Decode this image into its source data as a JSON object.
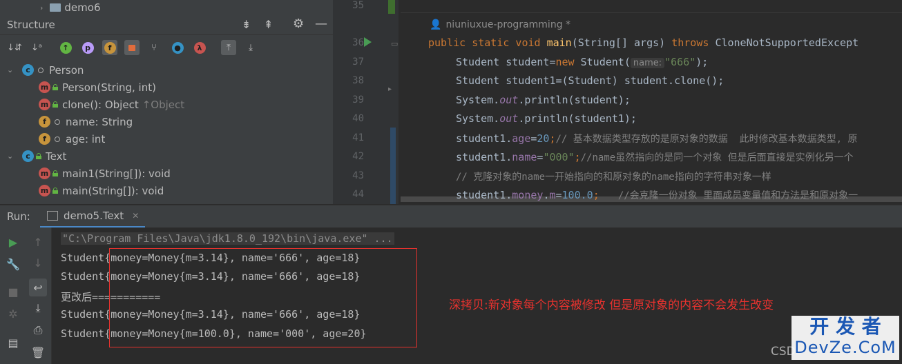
{
  "project_tree": {
    "folder_label": "demo6"
  },
  "structure": {
    "title": "Structure",
    "tree": [
      {
        "kind": "class",
        "label": "Person"
      },
      {
        "kind": "method",
        "label": "Person(String, int)"
      },
      {
        "kind": "method",
        "label": "clone(): Object",
        "suffix": "↑Object"
      },
      {
        "kind": "field",
        "label": "name: String"
      },
      {
        "kind": "field",
        "label": "age: int"
      },
      {
        "kind": "class",
        "label": "Text"
      },
      {
        "kind": "method",
        "label": "main1(String[]): void"
      },
      {
        "kind": "method",
        "label": "main(String[]): void"
      }
    ]
  },
  "editor": {
    "author_hint": "niuniuxue-programming *",
    "line_numbers": [
      "35",
      "36",
      "37",
      "38",
      "39",
      "40",
      "41",
      "42",
      "43",
      "44"
    ],
    "lines": {
      "l36": {
        "a": "public static void ",
        "fn": "main",
        "b": "(String[] args) ",
        "c": "throws ",
        "d": "CloneNotSupportedExcept"
      },
      "l37": {
        "a": "Student student=",
        "kw": "new ",
        "b": "Student(",
        "hint": "name:",
        "str": "\"666\"",
        "c": ");"
      },
      "l38": {
        "a": "Student student1=(Student) student.clone();"
      },
      "l39": {
        "a": "System.",
        "f": "out",
        "b": ".println(student);"
      },
      "l40": {
        "a": "System.",
        "f": "out",
        "b": ".println(student1);"
      },
      "l41": {
        "a": "student1.",
        "f": "age",
        "b": "=",
        "n": "20",
        "c": ";",
        "cm": "// 基本数据类型存放的是原对象的数据  此时修改基本数据类型, 原"
      },
      "l42": {
        "a": "student1.",
        "f": "name",
        "b": "=",
        "s": "\"000\"",
        "c": ";",
        "cm": "//name虽然指向的是同一个对象 但是后面直接是实例化另一个"
      },
      "l43": {
        "cm": "// 克隆对象的name一开始指向的和原对象的name指向的字符串对象一样"
      },
      "l44": {
        "a": "student1.",
        "f": "money",
        "b": ".",
        "f2": "m",
        "c": "=",
        "n": "100.0",
        "d": ";   ",
        "cm": "//会克隆一份对象 里面成员变量值和方法是和原对象一"
      }
    }
  },
  "run": {
    "label": "Run:",
    "tab": "demo5.Text",
    "output": [
      "\"C:\\Program Files\\Java\\jdk1.8.0_192\\bin\\java.exe\" ...",
      "Student{money=Money{m=3.14}, name='666', age=18}",
      "Student{money=Money{m=3.14}, name='666', age=18}",
      "更改后===========",
      "Student{money=Money{m=3.14}, name='666', age=18}",
      "Student{money=Money{m=100.0}, name='000', age=20}"
    ],
    "annotation": "深拷贝:新对象每个内容被修改 但是原对象的内容不会发生改变",
    "watermark_cn": "开 发 者",
    "watermark_en": "DevZe.CoM",
    "watermark_partial": "CSD"
  },
  "colors": {
    "accent_red": "#e8322e",
    "class_icon": "#3592c4",
    "method_icon": "#c75450",
    "field_icon": "#c7943c"
  }
}
